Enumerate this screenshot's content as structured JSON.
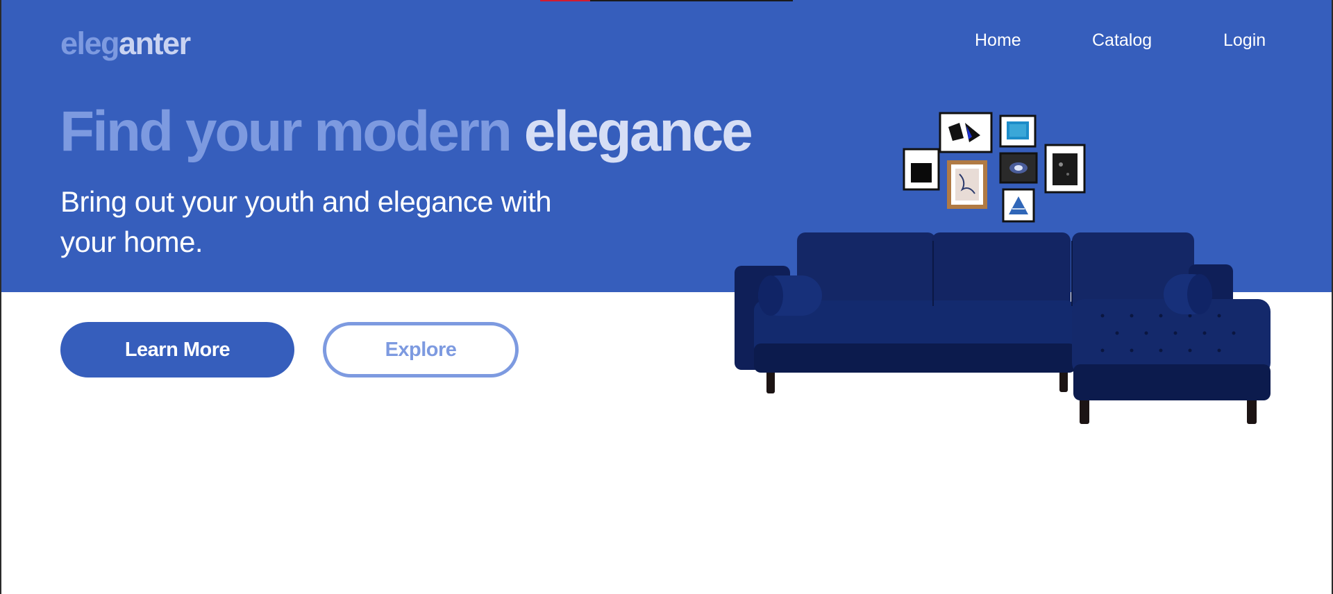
{
  "logo": {
    "part1": "eleg",
    "part2": "anter"
  },
  "nav": {
    "home": "Home",
    "catalog": "Catalog",
    "login": "Login"
  },
  "hero": {
    "headline_part1": "Find your modern",
    "headline_part2": "elegance",
    "subhead": "Bring out your youth and elegance with your home.",
    "learn_more": "Learn More",
    "explore": "Explore"
  },
  "icons": {
    "hero_image": "sofa-with-gallery-wall-image"
  },
  "colors": {
    "brand_blue": "#365ebc",
    "accent_light": "#7d9ae0",
    "accent_pale": "#c9d3f1",
    "sofa_navy": "#0e1f5c",
    "white": "#ffffff"
  }
}
